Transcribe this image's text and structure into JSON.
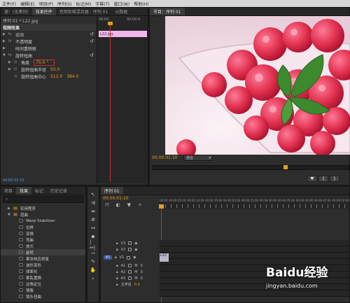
{
  "menubar": {
    "items": [
      "文件(F)",
      "编辑(E)",
      "项目(P)",
      "序列(S)",
      "标记(M)",
      "字幕(T)",
      "窗口(W)",
      "帮助(H)"
    ]
  },
  "effect_controls": {
    "tabs": [
      "源：(无素材)",
      "效果控件",
      "音频剪辑混合器：序列 01",
      "元数据"
    ],
    "sequence_label": "序列 01 * L22.jpg",
    "timecode_start": "00:00",
    "timecode_end": "00:00:0",
    "clip_label": "L22.jpg",
    "video_effects_label": "视频效果",
    "rows": [
      {
        "label": "运动",
        "fx": "fx"
      },
      {
        "label": "不透明度",
        "fx": "fx"
      },
      {
        "label": "时间重映射",
        "fx": ""
      },
      {
        "label": "旋转扭曲",
        "fx": "fx"
      }
    ],
    "angle_label": "角度",
    "angle_value": "75.0 °",
    "radius_label": "旋转扭曲半径",
    "radius_value": "50.0",
    "center_label": "旋转扭曲中心",
    "center_x": "512.0",
    "center_y": "384.0",
    "bottom_time": "00:00:01:10"
  },
  "program": {
    "tab": "节目：序列 01",
    "timecode": "00:00:01:10",
    "fit": "适合",
    "colors": {
      "bg": "#f0dce6",
      "accent": "#e0a020"
    }
  },
  "project": {
    "tabs": [
      "项目",
      "效果",
      "标记",
      "历史记录"
    ],
    "search_placeholder": "",
    "items": [
      {
        "label": "实用程序",
        "level": 0
      },
      {
        "label": "扭曲",
        "level": 0
      },
      {
        "label": "Warp Stabilizer",
        "level": 1
      },
      {
        "label": "位移",
        "level": 1
      },
      {
        "label": "变换",
        "level": 1
      },
      {
        "label": "弯曲",
        "level": 1
      },
      {
        "label": "放大",
        "level": 1
      },
      {
        "label": "旋转",
        "level": 1
      },
      {
        "label": "果冻效应修复",
        "level": 1
      },
      {
        "label": "波形变形",
        "level": 1
      },
      {
        "label": "球面化",
        "level": 1
      },
      {
        "label": "紊乱置换",
        "level": 1
      },
      {
        "label": "边角定位",
        "level": 1
      },
      {
        "label": "镜像",
        "level": 1
      },
      {
        "label": "镜头扭曲",
        "level": 1
      }
    ]
  },
  "timeline": {
    "tab": "序列 01",
    "timecode": "00:00:01:10",
    "ruler": [
      "00:00",
      "00:00:05:00",
      "00:00:10:00",
      "00:00:15:00",
      "00:00:20:00",
      "00:00:25:00",
      "00:00:30:00",
      "00:00:35:00",
      "00:00:40:00",
      "00:00:45:00",
      "00:00:50:00"
    ],
    "tracks": [
      "V3",
      "V2",
      "V1",
      "A1",
      "A2",
      "A3",
      "主声道"
    ],
    "source_patch": "V1",
    "master_value": "0.0",
    "clip_label": "L22"
  },
  "watermark": {
    "brand": "Baidu经验",
    "url": "jingyan.baidu.com"
  }
}
